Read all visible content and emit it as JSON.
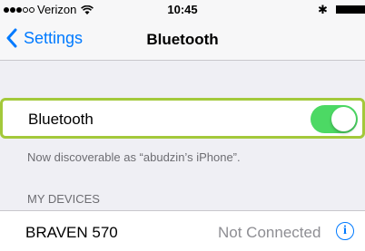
{
  "status_bar": {
    "signal_icon": "signal-dots-icon",
    "carrier": "Verizon",
    "wifi_icon": "wifi-icon",
    "time": "10:45",
    "bluetooth_symbol": "✱",
    "battery_icon": "battery-icon"
  },
  "nav": {
    "back_label": "Settings",
    "back_icon": "chevron-left-icon",
    "title": "Bluetooth"
  },
  "bluetooth_row": {
    "label": "Bluetooth",
    "toggle_on": true,
    "toggle_color": "#4cd964",
    "highlight_color": "#a3c93a"
  },
  "discoverable_text": "Now discoverable as “abudzin’s iPhone”.",
  "my_devices": {
    "header": "MY DEVICES",
    "devices": [
      {
        "name": "BRAVEN 570",
        "status": "Not Connected",
        "info_icon": "info-icon"
      }
    ]
  },
  "accent_color": "#007aff"
}
